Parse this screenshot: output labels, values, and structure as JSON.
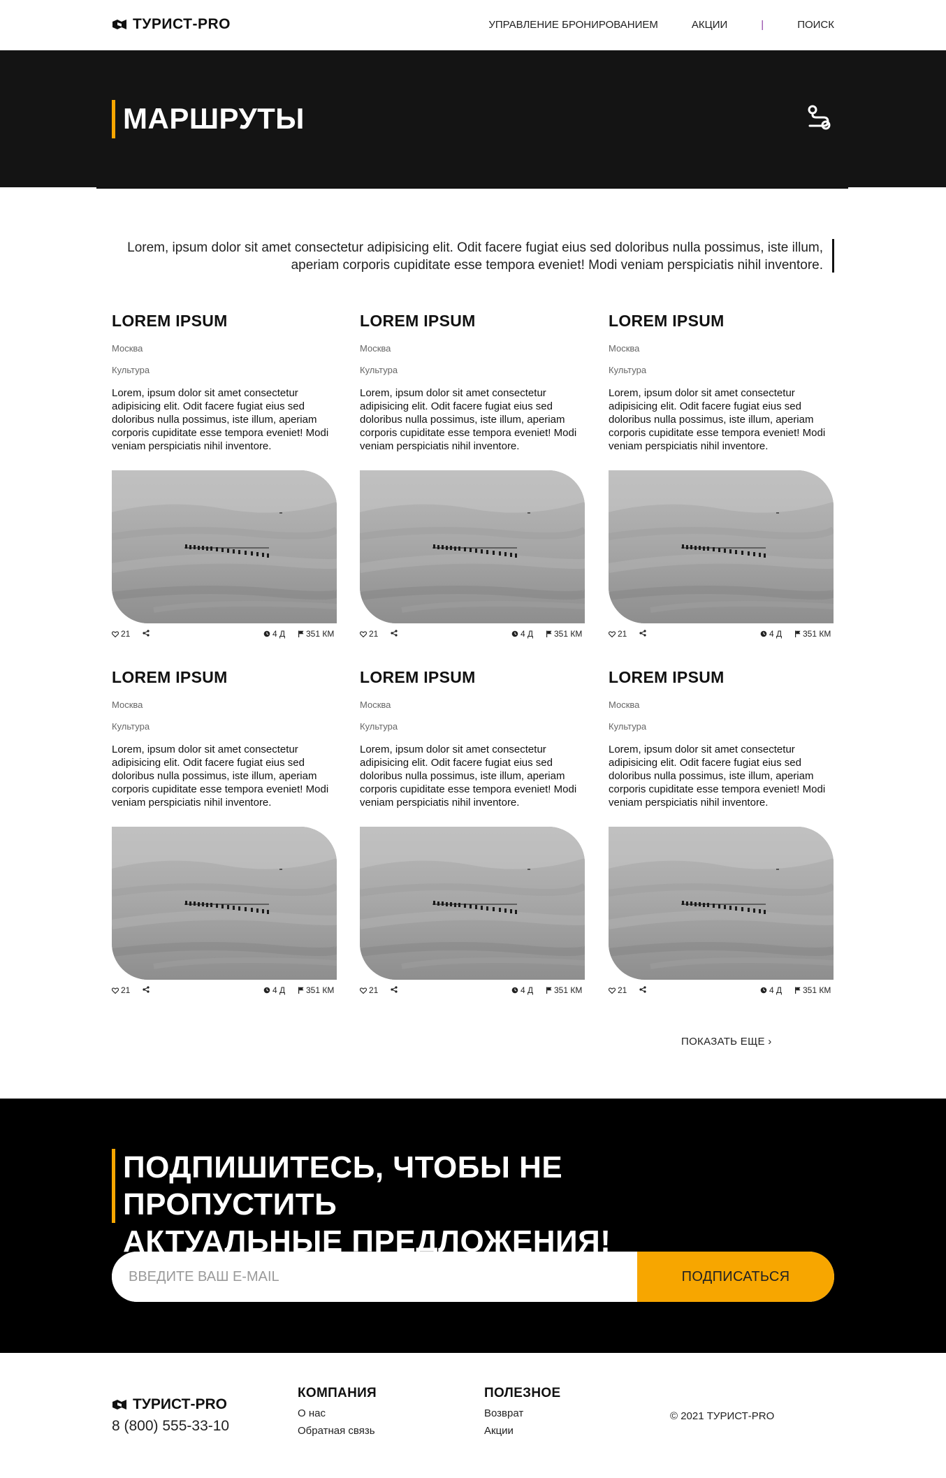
{
  "brand": {
    "name": "ТУРИСТ-PRO"
  },
  "nav": {
    "booking": "УПРАВЛЕНИЕ БРОНИРОВАНИЕМ",
    "promo": "АКЦИИ",
    "divider": "|",
    "search": "ПОИСК"
  },
  "hero": {
    "title": "МАРШРУТЫ",
    "icon": "route-icon"
  },
  "intro": {
    "text": "Lorem, ipsum dolor sit amet consectetur adipisicing elit. Odit facere fugiat eius sed doloribus nulla possimus, iste illum, aperiam corporis cupiditate esse tempora eveniet! Modi veniam perspiciatis nihil inventore."
  },
  "cards": [
    {
      "title": "LOREM IPSUM",
      "city": "Москва",
      "category": "Культура",
      "description": "Lorem, ipsum dolor sit amet consectetur adipisicing elit. Odit facere fugiat eius sed doloribus nulla possimus, iste illum, aperiam corporis cupiditate esse tempora eveniet! Modi veniam perspiciatis nihil inventore.",
      "likes": "21",
      "days": "4 Д",
      "distance": "351 КМ"
    },
    {
      "title": "LOREM IPSUM",
      "city": "Москва",
      "category": "Культура",
      "description": "Lorem, ipsum dolor sit amet consectetur adipisicing elit. Odit facere fugiat eius sed doloribus nulla possimus, iste illum, aperiam corporis cupiditate esse tempora eveniet! Modi veniam perspiciatis nihil inventore.",
      "likes": "21",
      "days": "4 Д",
      "distance": "351 КМ"
    },
    {
      "title": "LOREM IPSUM",
      "city": "Москва",
      "category": "Культура",
      "description": "Lorem, ipsum dolor sit amet consectetur adipisicing elit. Odit facere fugiat eius sed doloribus nulla possimus, iste illum, aperiam corporis cupiditate esse tempora eveniet! Modi veniam perspiciatis nihil inventore.",
      "likes": "21",
      "days": "4 Д",
      "distance": "351 КМ"
    },
    {
      "title": "LOREM IPSUM",
      "city": "Москва",
      "category": "Культура",
      "description": "Lorem, ipsum dolor sit amet consectetur adipisicing elit. Odit facere fugiat eius sed doloribus nulla possimus, iste illum, aperiam corporis cupiditate esse tempora eveniet! Modi veniam perspiciatis nihil inventore.",
      "likes": "21",
      "days": "4 Д",
      "distance": "351 КМ"
    },
    {
      "title": "LOREM IPSUM",
      "city": "Москва",
      "category": "Культура",
      "description": "Lorem, ipsum dolor sit amet consectetur adipisicing elit. Odit facere fugiat eius sed doloribus nulla possimus, iste illum, aperiam corporis cupiditate esse tempora eveniet! Modi veniam perspiciatis nihil inventore.",
      "likes": "21",
      "days": "4 Д",
      "distance": "351 КМ"
    },
    {
      "title": "LOREM IPSUM",
      "city": "Москва",
      "category": "Культура",
      "description": "Lorem, ipsum dolor sit amet consectetur adipisicing elit. Odit facere fugiat eius sed doloribus nulla possimus, iste illum, aperiam corporis cupiditate esse tempora eveniet! Modi veniam perspiciatis nihil inventore.",
      "likes": "21",
      "days": "4 Д",
      "distance": "351 КМ"
    }
  ],
  "show_more": "ПОКАЗАТЬ ЕЩЕ ›",
  "subscribe": {
    "title_line1": "ПОДПИШИТЕСЬ, ЧТОБЫ НЕ ПРОПУСТИТЬ",
    "title_line2": "АКТУАЛЬНЫЕ ПРЕДЛОЖЕНИЯ!",
    "placeholder": "ВВЕДИТЕ ВАШ E-MAIL",
    "button": "ПОДПИСАТЬСЯ"
  },
  "footer": {
    "phone": "8 (800) 555-33-10",
    "company": {
      "title": "КОМПАНИЯ",
      "links": [
        "О нас",
        "Обратная связь"
      ]
    },
    "useful": {
      "title": "ПОЛЕЗНОЕ",
      "links": [
        "Возврат",
        "Акции"
      ]
    },
    "copyright": "© 2021 ТУРИСТ-PRO"
  },
  "colors": {
    "accent": "#f7a600",
    "dark": "#141414",
    "black": "#000000"
  }
}
